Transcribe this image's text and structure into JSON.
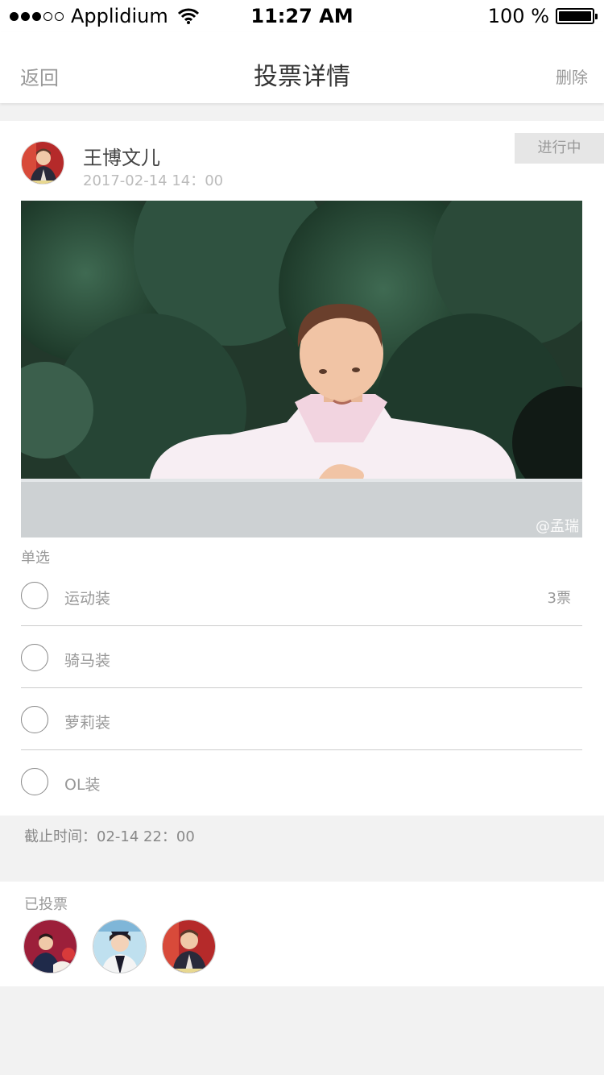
{
  "status_bar": {
    "carrier": "Applidium",
    "time": "11:27 AM",
    "battery_text": "100 %"
  },
  "nav": {
    "back_label": "返回",
    "title": "投票详情",
    "delete_label": "删除"
  },
  "post": {
    "author_name": "王博文儿",
    "date": "2017-02-14  14：00",
    "status": "进行中",
    "photo_watermark": "@孟瑞"
  },
  "vote": {
    "type_label": "单选",
    "options": [
      {
        "label": "运动装",
        "count": "3票"
      },
      {
        "label": "骑马装",
        "count": ""
      },
      {
        "label": "萝莉装",
        "count": ""
      },
      {
        "label": "OL装",
        "count": ""
      }
    ],
    "deadline": "截止时间：02-14 22：00"
  },
  "voted": {
    "title": "已投票"
  },
  "colors": {
    "background": "#f2f2f2",
    "muted_text": "#999999",
    "badge_bg": "#e6e6e6"
  }
}
